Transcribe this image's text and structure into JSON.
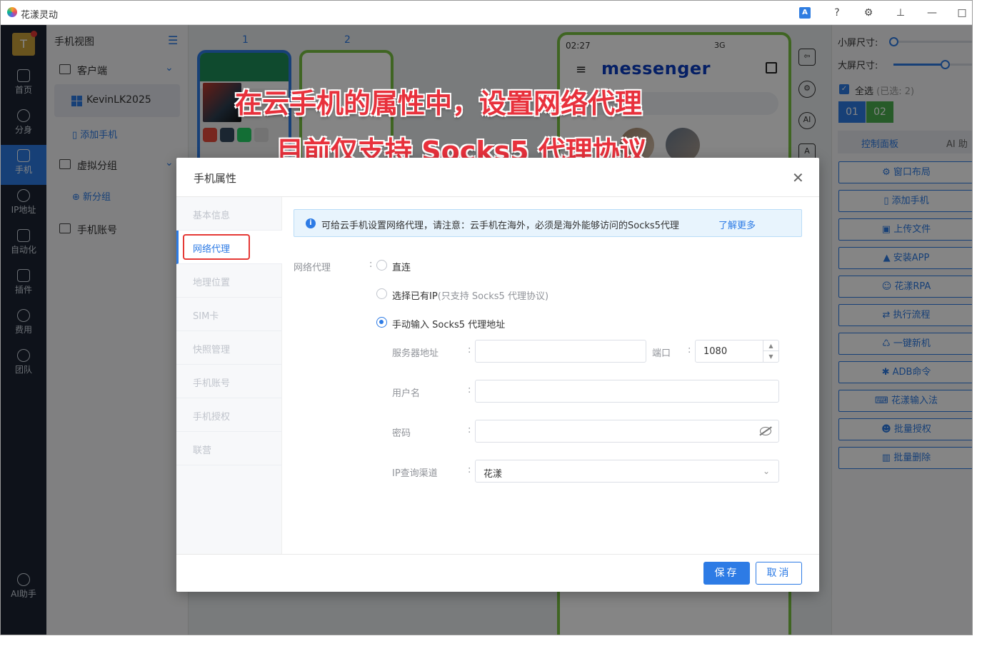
{
  "app": {
    "title": "花漾灵动"
  },
  "leftnav": {
    "avatar": "T",
    "items": [
      {
        "label": "首页",
        "icon": "home-icon"
      },
      {
        "label": "分身",
        "icon": "chrome-icon"
      },
      {
        "label": "手机",
        "icon": "phone-icon",
        "active": true
      },
      {
        "label": "IP地址",
        "icon": "ip-icon"
      },
      {
        "label": "自动化",
        "icon": "robot-icon"
      },
      {
        "label": "插件",
        "icon": "puzzle-icon"
      },
      {
        "label": "费用",
        "icon": "yen-icon"
      },
      {
        "label": "团队",
        "icon": "team-icon"
      }
    ],
    "ai": "AI助手"
  },
  "panel2": {
    "title": "手机视图",
    "client": "客户端",
    "device": "KevinLK2025",
    "add_phone": "添加手机",
    "virtual_group": "虚拟分组",
    "new_group": "新分组",
    "phone_account": "手机账号"
  },
  "main": {
    "col1": "1",
    "col2": "2",
    "phone": {
      "time": "02:27",
      "status": "3G",
      "brand": "messenger"
    }
  },
  "captions": {
    "line1": "在云手机的属性中，设置网络代理",
    "line2": "目前仅支持 Socks5 代理协议"
  },
  "rpanel": {
    "small_size": "小屏尺寸:",
    "small_value": 0,
    "large_size": "大屏尺寸:",
    "large_value": 0.6,
    "select_all": "全选",
    "selected": "(已选: 2)",
    "tags": [
      "01",
      "02"
    ],
    "tab_control": "控制面板",
    "tab_ai": "AI 助",
    "actions": [
      "窗口布局",
      "添加手机",
      "上传文件",
      "安装APP",
      "花漾RPA",
      "执行流程",
      "一键新机",
      "ADB命令",
      "花漾输入法",
      "批量授权",
      "批量删除"
    ]
  },
  "dialog": {
    "title": "手机属性",
    "tabs": [
      "基本信息",
      "网络代理",
      "地理位置",
      "SIM卡",
      "快照管理",
      "手机账号",
      "手机授权",
      "联营"
    ],
    "info": "可给云手机设置网络代理，请注意：云手机在海外，必须是海外能够访问的Socks5代理",
    "info_link": "了解更多",
    "proxy_label": "网络代理",
    "opt_direct": "直连",
    "opt_existing": "选择已有IP",
    "opt_existing_note": "(只支持 Socks5 代理协议)",
    "opt_manual": "手动输入 Socks5 代理地址",
    "server_label": "服务器地址",
    "server_value": "",
    "port_label": "端口",
    "port_value": "1080",
    "user_label": "用户名",
    "user_value": "",
    "pwd_label": "密码",
    "pwd_value": "",
    "ipq_label": "IP查询渠道",
    "ipq_value": "花漾",
    "save": "保存",
    "cancel": "取消"
  }
}
